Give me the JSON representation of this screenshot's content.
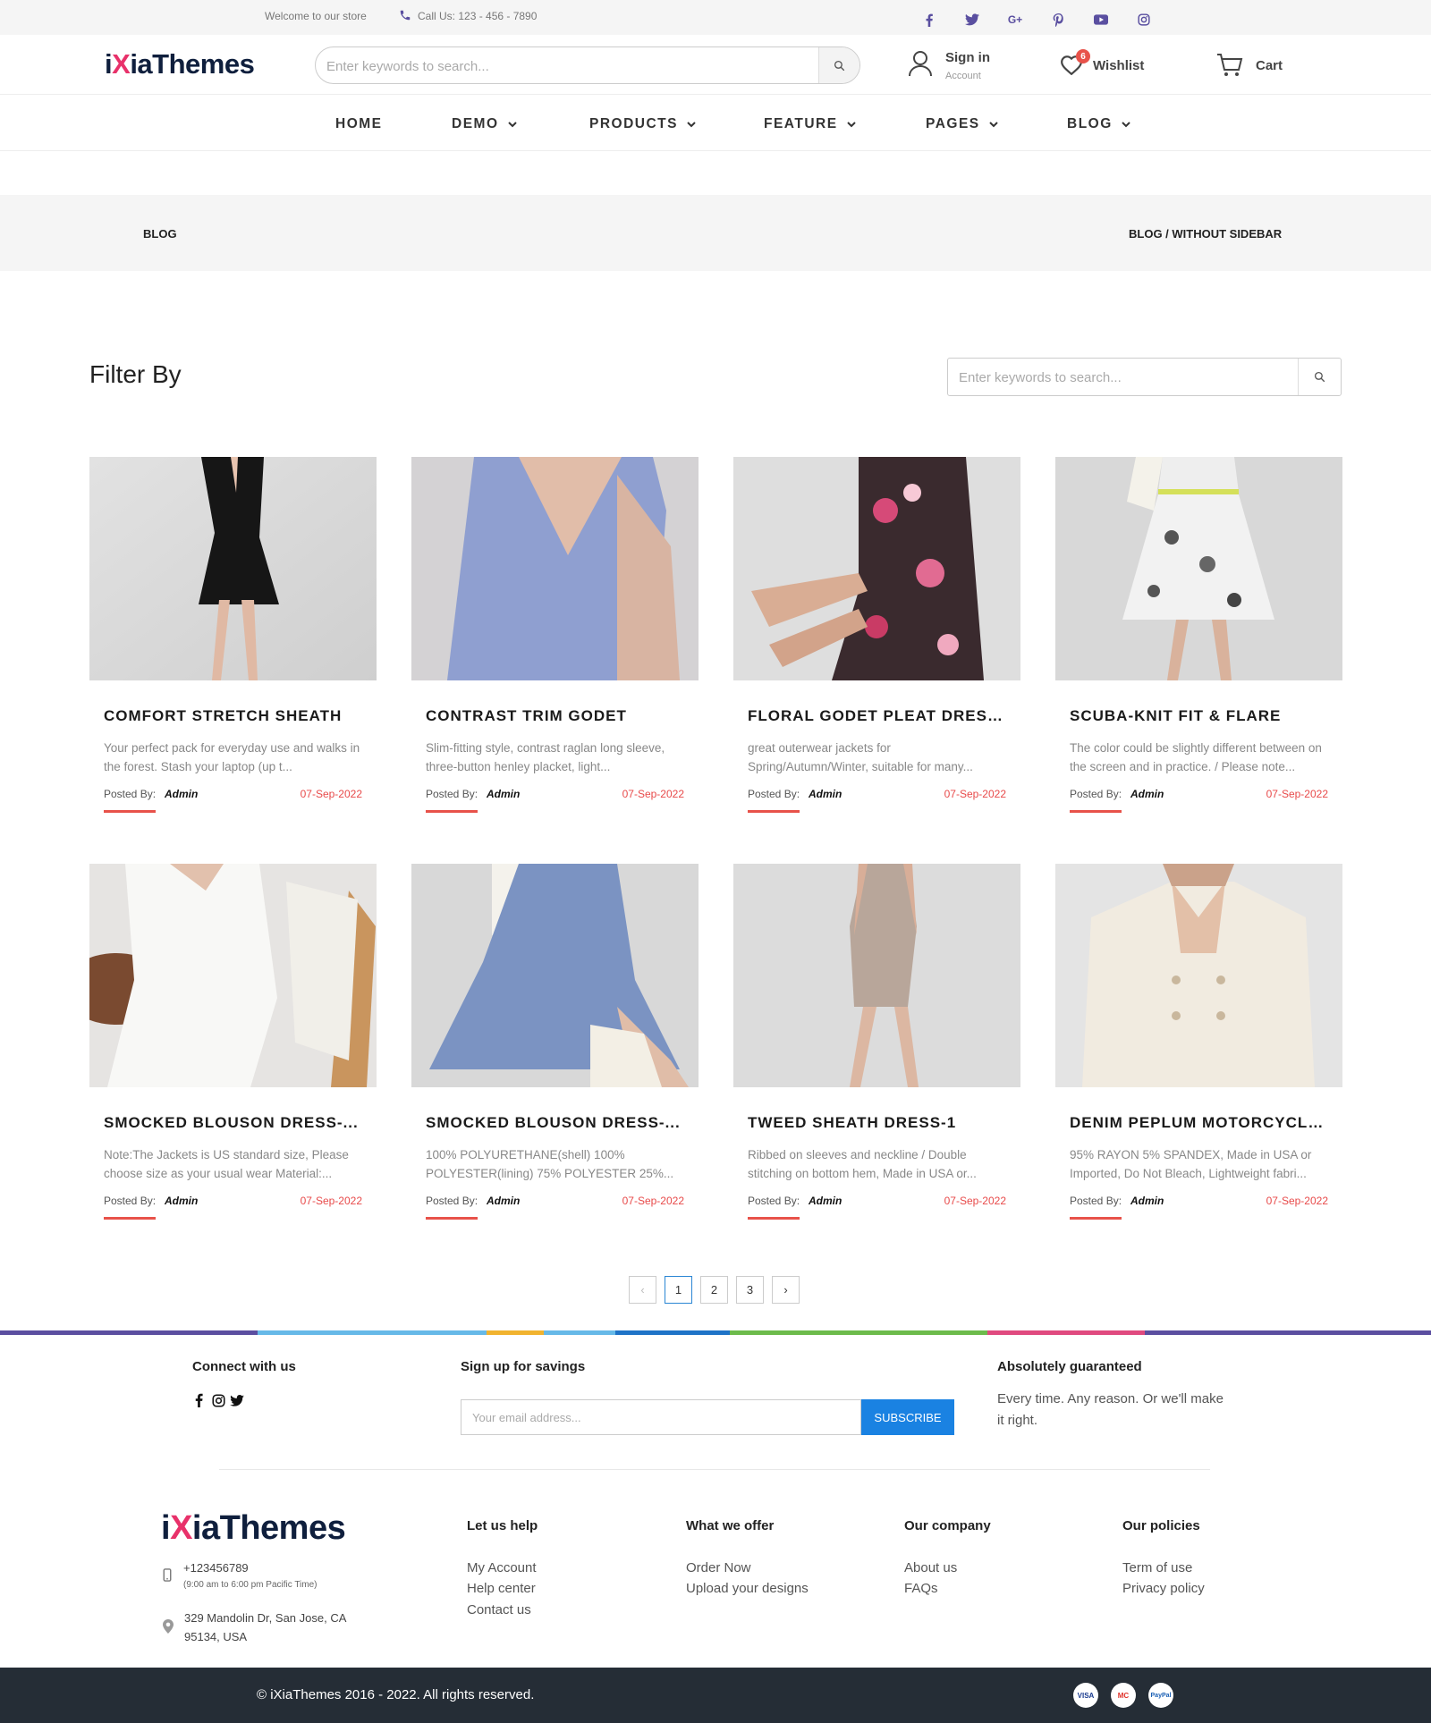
{
  "topbar": {
    "welcome": "Welcome to our store",
    "call": "Call Us: 123 - 456 - 7890",
    "social_icons": [
      "facebook-icon",
      "twitter-icon",
      "google-plus-icon",
      "pinterest-icon",
      "youtube-icon",
      "instagram-icon"
    ]
  },
  "header": {
    "logo_prefix": "i",
    "logo_x": "X",
    "logo_suffix": "iaThemes",
    "search_placeholder": "Enter keywords to search...",
    "signin_label": "Sign in",
    "signin_sub": "Account",
    "wishlist_label": "Wishlist",
    "wishlist_count": "6",
    "cart_label": "Cart"
  },
  "nav": {
    "items": [
      {
        "label": "HOME",
        "dropdown": false
      },
      {
        "label": "DEMO",
        "dropdown": true
      },
      {
        "label": "PRODUCTS",
        "dropdown": true
      },
      {
        "label": "FEATURE",
        "dropdown": true
      },
      {
        "label": "PAGES",
        "dropdown": true
      },
      {
        "label": "BLOG",
        "dropdown": true
      }
    ]
  },
  "breadcrumb": {
    "title": "BLOG",
    "path": "BLOG / WITHOUT SIDEBAR"
  },
  "filter": {
    "title": "Filter By",
    "search_placeholder": "Enter keywords to search..."
  },
  "posts": [
    {
      "title": "COMFORT STRETCH SHEATH",
      "desc": "Your perfect pack for everyday use and walks in the forest. Stash your laptop (up t...",
      "posted_by": "Posted By:",
      "author": "Admin",
      "date": "07-Sep-2022"
    },
    {
      "title": "CONTRAST TRIM GODET",
      "desc": "Slim-fitting style, contrast raglan long sleeve, three-button henley placket, light...",
      "posted_by": "Posted By:",
      "author": "Admin",
      "date": "07-Sep-2022"
    },
    {
      "title": "FLORAL GODET PLEAT DRESS...",
      "desc": "great outerwear jackets for Spring/Autumn/Winter, suitable for many...",
      "posted_by": "Posted By:",
      "author": "Admin",
      "date": "07-Sep-2022"
    },
    {
      "title": "SCUBA-KNIT FIT & FLARE",
      "desc": "The color could be slightly different between on the screen and in practice. / Please note...",
      "posted_by": "Posted By:",
      "author": "Admin",
      "date": "07-Sep-2022"
    },
    {
      "title": "SMOCKED BLOUSON DRESS-...",
      "desc": "Note:The Jackets is US standard size, Please choose size as your usual wear Material:...",
      "posted_by": "Posted By:",
      "author": "Admin",
      "date": "07-Sep-2022"
    },
    {
      "title": "SMOCKED BLOUSON DRESS-...",
      "desc": "100% POLYURETHANE(shell) 100% POLYESTER(lining) 75% POLYESTER 25%...",
      "posted_by": "Posted By:",
      "author": "Admin",
      "date": "07-Sep-2022"
    },
    {
      "title": "TWEED SHEATH DRESS-1",
      "desc": "Ribbed on sleeves and neckline / Double stitching on bottom hem, Made in USA or...",
      "posted_by": "Posted By:",
      "author": "Admin",
      "date": "07-Sep-2022"
    },
    {
      "title": "DENIM PEPLUM MOTORCYCLE...",
      "desc": "95% RAYON 5% SPANDEX, Made in USA or Imported, Do Not Bleach, Lightweight fabri...",
      "posted_by": "Posted By:",
      "author": "Admin",
      "date": "07-Sep-2022"
    }
  ],
  "pagination": {
    "prev": "‹",
    "pages": [
      "1",
      "2",
      "3"
    ],
    "current": "1",
    "next": "›"
  },
  "footer": {
    "connect_title": "Connect with us",
    "connect_icons": [
      "facebook-icon",
      "instagram-icon",
      "twitter-icon"
    ],
    "signup_title": "Sign up for savings",
    "email_placeholder": "Your email address...",
    "subscribe_label": "SUBSCRIBE",
    "guarantee_title": "Absolutely guaranteed",
    "guarantee_text": "Every time. Any reason. Or we'll make it right.",
    "phone": "+123456789",
    "hours": "(9:00 am to 6:00 pm Pacific Time)",
    "address_line1": "329 Mandolin Dr, San Jose, CA",
    "address_line2": "95134, USA",
    "columns": [
      {
        "title": "Let us help",
        "links": [
          "My Account",
          "Help center",
          "Contact us"
        ]
      },
      {
        "title": "What we offer",
        "links": [
          "Order Now",
          "Upload your designs"
        ]
      },
      {
        "title": "Our company",
        "links": [
          "About us",
          "FAQs"
        ]
      },
      {
        "title": "Our policies",
        "links": [
          "Term of use",
          "Privacy policy"
        ]
      }
    ],
    "copyright": "© iXiaThemes 2016 - 2022. All rights reserved.",
    "payment_icons": [
      "visa-icon",
      "mastercard-icon",
      "paypal-icon"
    ],
    "payment_labels": [
      "VISA",
      "MC",
      "PayPal"
    ]
  },
  "colors": {
    "accent_red": "#e8524a",
    "logo_pink": "#e8316a",
    "subscribe_blue": "#1a82e2",
    "social_purple": "#5a4fa0",
    "footer_dark": "#252d36"
  }
}
